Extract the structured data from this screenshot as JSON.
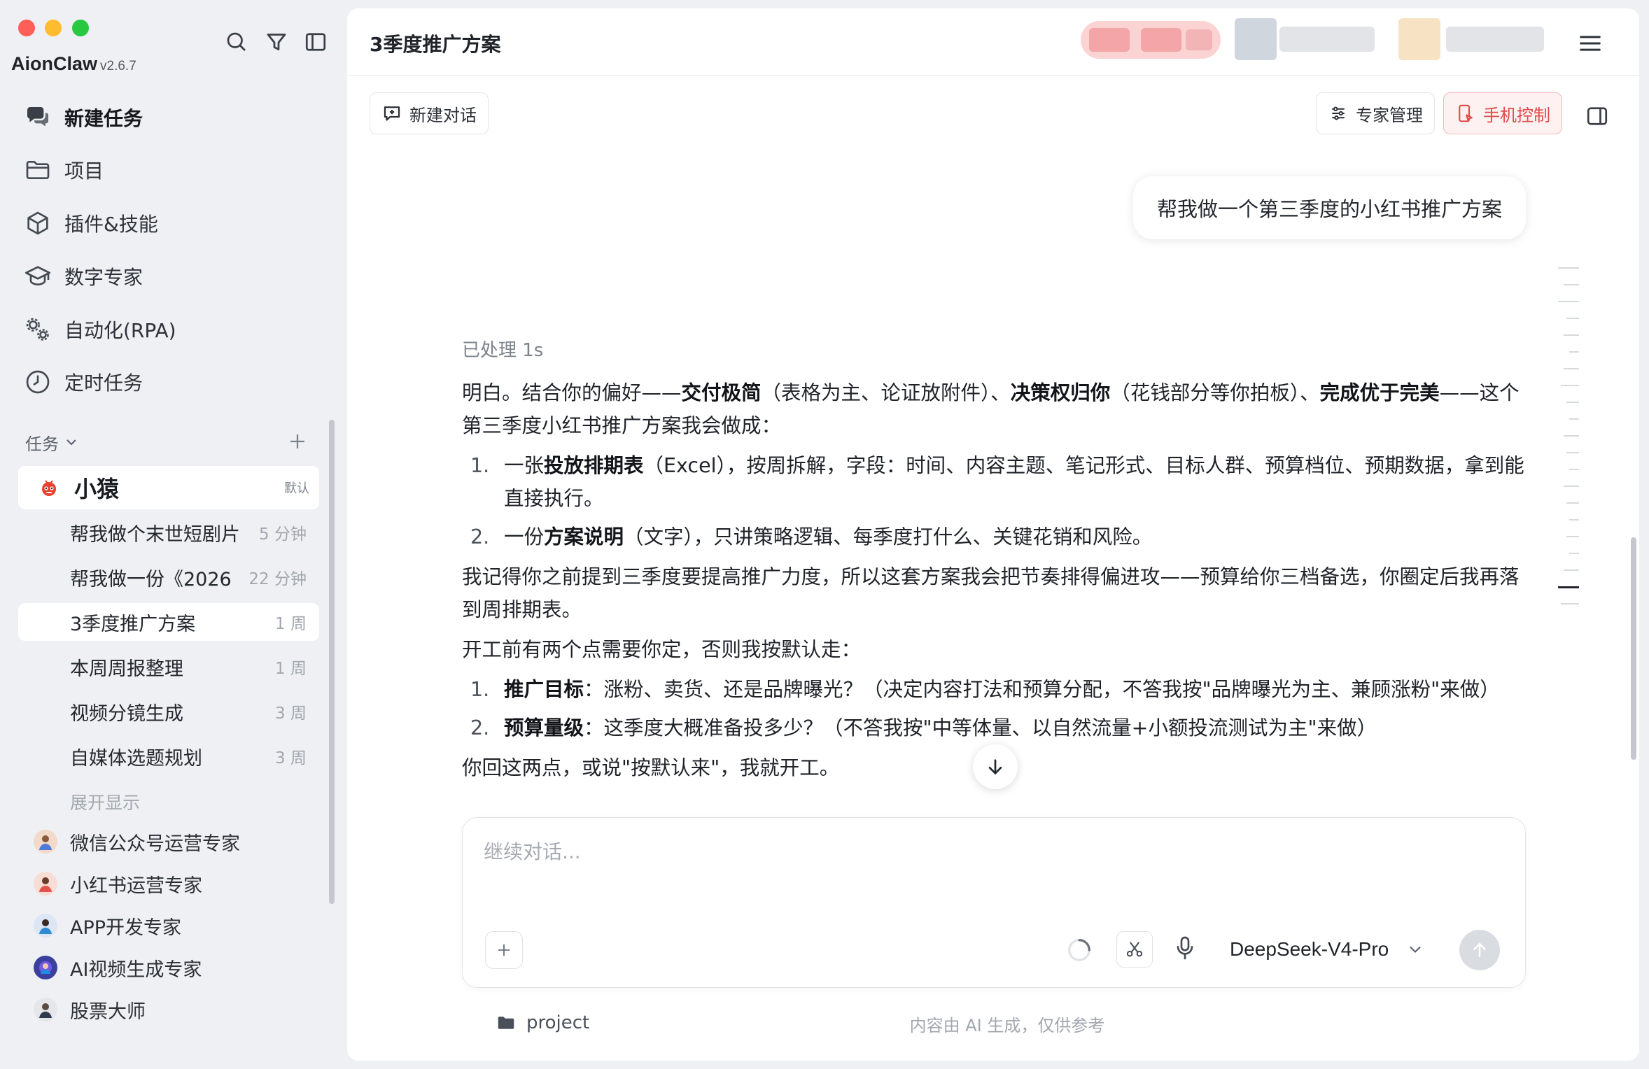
{
  "app": {
    "name": "AionClaw",
    "version": "v2.6.7"
  },
  "colors": {
    "accent_red": "#e34a4a",
    "sidebar_bg": "#eef0f3",
    "panel_bg": "#ffffff"
  },
  "sidebar": {
    "nav": [
      {
        "label": "新建任务",
        "icon": "chat-bubbles-icon"
      },
      {
        "label": "项目",
        "icon": "folder-icon"
      },
      {
        "label": "插件&技能",
        "icon": "cube-icon"
      },
      {
        "label": "数字专家",
        "icon": "graduation-cap-icon"
      },
      {
        "label": "自动化(RPA)",
        "icon": "gears-icon"
      },
      {
        "label": "定时任务",
        "icon": "clock-icon"
      }
    ],
    "tasks_header": "任务",
    "group": {
      "name": "小猿",
      "badge": "默认"
    },
    "tasks": [
      {
        "title": "帮我做个末世短剧片",
        "time": "5 分钟"
      },
      {
        "title": "帮我做一份《2026",
        "time": "22 分钟"
      },
      {
        "title": "3季度推广方案",
        "time": "1 周"
      },
      {
        "title": "本周周报整理",
        "time": "1 周"
      },
      {
        "title": "视频分镜生成",
        "time": "3 周"
      },
      {
        "title": "自媒体选题规划",
        "time": "3 周"
      }
    ],
    "show_more": "展开显示",
    "experts": [
      {
        "name": "微信公众号运营专家"
      },
      {
        "name": "小红书运营专家"
      },
      {
        "name": "APP开发专家"
      },
      {
        "name": "AI视频生成专家"
      },
      {
        "name": "股票大师"
      }
    ]
  },
  "main": {
    "title": "3季度推广方案",
    "toolbar": {
      "new_chat": "新建对话",
      "expert_manage": "专家管理",
      "phone_control": "手机控制"
    },
    "user_message": "帮我做一个第三季度的小红书推广方案",
    "processed": "已处理 1s",
    "answer": {
      "p1_a": "明白。结合你的偏好——",
      "p1_b1": "交付极简",
      "p1_c": "（表格为主、论证放附件）、",
      "p1_b2": "决策权归你",
      "p1_d": "（花钱部分等你拍板）、",
      "p1_b3": "完成优于完美",
      "p1_e": "——这个第三季度小红书推广方案我会做成：",
      "list1": [
        {
          "num": "1.",
          "a": "一张",
          "b": "投放排期表",
          "c": "（Excel），按周拆解，字段：时间、内容主题、笔记形式、目标人群、预算档位、预期数据，拿到能直接执行。"
        },
        {
          "num": "2.",
          "a": "一份",
          "b": "方案说明",
          "c": "（文字），只讲策略逻辑、每季度打什么、关键花销和风险。"
        }
      ],
      "p2": "我记得你之前提到三季度要提高推广力度，所以这套方案我会把节奏排得偏进攻——预算给你三档备选，你圈定后我再落到周排期表。",
      "p3": "开工前有两个点需要你定，否则我按默认走：",
      "list2": [
        {
          "num": "1.",
          "b": "推广目标",
          "c": "：涨粉、卖货、还是品牌曝光？（决定内容打法和预算分配，不答我按\"品牌曝光为主、兼顾涨粉\"来做）"
        },
        {
          "num": "2.",
          "b": "预算量级",
          "c": "：这季度大概准备投多少？（不答我按\"中等体量、以自然流量+小额投流测试为主\"来做）"
        }
      ],
      "p4": "你回这两点，或说\"按默认来\"，我就开工。"
    },
    "composer": {
      "placeholder": "继续对话...",
      "model": "DeepSeek-V4-Pro"
    },
    "footer": {
      "project": "project",
      "disclaimer": "内容由 AI 生成，仅供参考"
    }
  }
}
